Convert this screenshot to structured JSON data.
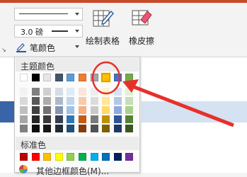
{
  "toolbar": {
    "pen_weight": "3.0 磅",
    "pen_color_label": "笔颜色",
    "draw_table_label": "绘制表格",
    "eraser_label": "橡皮擦"
  },
  "color_menu": {
    "theme_header": "主题颜色",
    "standard_header": "标准色",
    "more_colors_label": "其他边框颜色(M)...",
    "theme_colors": [
      "#ffffff",
      "#000000",
      "#e7e6e6",
      "#44546a",
      "#5b9bd5",
      "#ed7d31",
      "#a5a5a5",
      "#ffc000",
      "#4472c4",
      "#70ad47"
    ],
    "theme_shades": [
      [
        "#f2f2f2",
        "#d9d9d9",
        "#bfbfbf",
        "#a6a6a6",
        "#808080"
      ],
      [
        "#7f7f7f",
        "#595959",
        "#404040",
        "#262626",
        "#0d0d0d"
      ],
      [
        "#d0cece",
        "#aeabab",
        "#757171",
        "#3a3838",
        "#171616"
      ],
      [
        "#d6dce5",
        "#adb9ca",
        "#8497b0",
        "#333f50",
        "#222a35"
      ],
      [
        "#deebf7",
        "#bdd7ee",
        "#9dc3e6",
        "#2e75b6",
        "#1f4e79"
      ],
      [
        "#fbe5d6",
        "#f8cbad",
        "#f4b183",
        "#c55a11",
        "#843c0c"
      ],
      [
        "#ededed",
        "#dbdbdb",
        "#c9c9c9",
        "#7b7b7b",
        "#525252"
      ],
      [
        "#fff2cc",
        "#ffe699",
        "#ffd966",
        "#bf9000",
        "#7f6000"
      ],
      [
        "#dae3f3",
        "#b4c7e7",
        "#8faadc",
        "#2f5597",
        "#203864"
      ],
      [
        "#e2f0d9",
        "#c5e0b4",
        "#a9d18e",
        "#548235",
        "#385723"
      ]
    ],
    "standard_colors": [
      "#c00000",
      "#ff0000",
      "#ffc000",
      "#ffff00",
      "#92d050",
      "#00b050",
      "#00b0f0",
      "#0070c0",
      "#002060",
      "#7030a0"
    ],
    "selected_theme_index": 7
  },
  "annotation_color": "#e8302a"
}
